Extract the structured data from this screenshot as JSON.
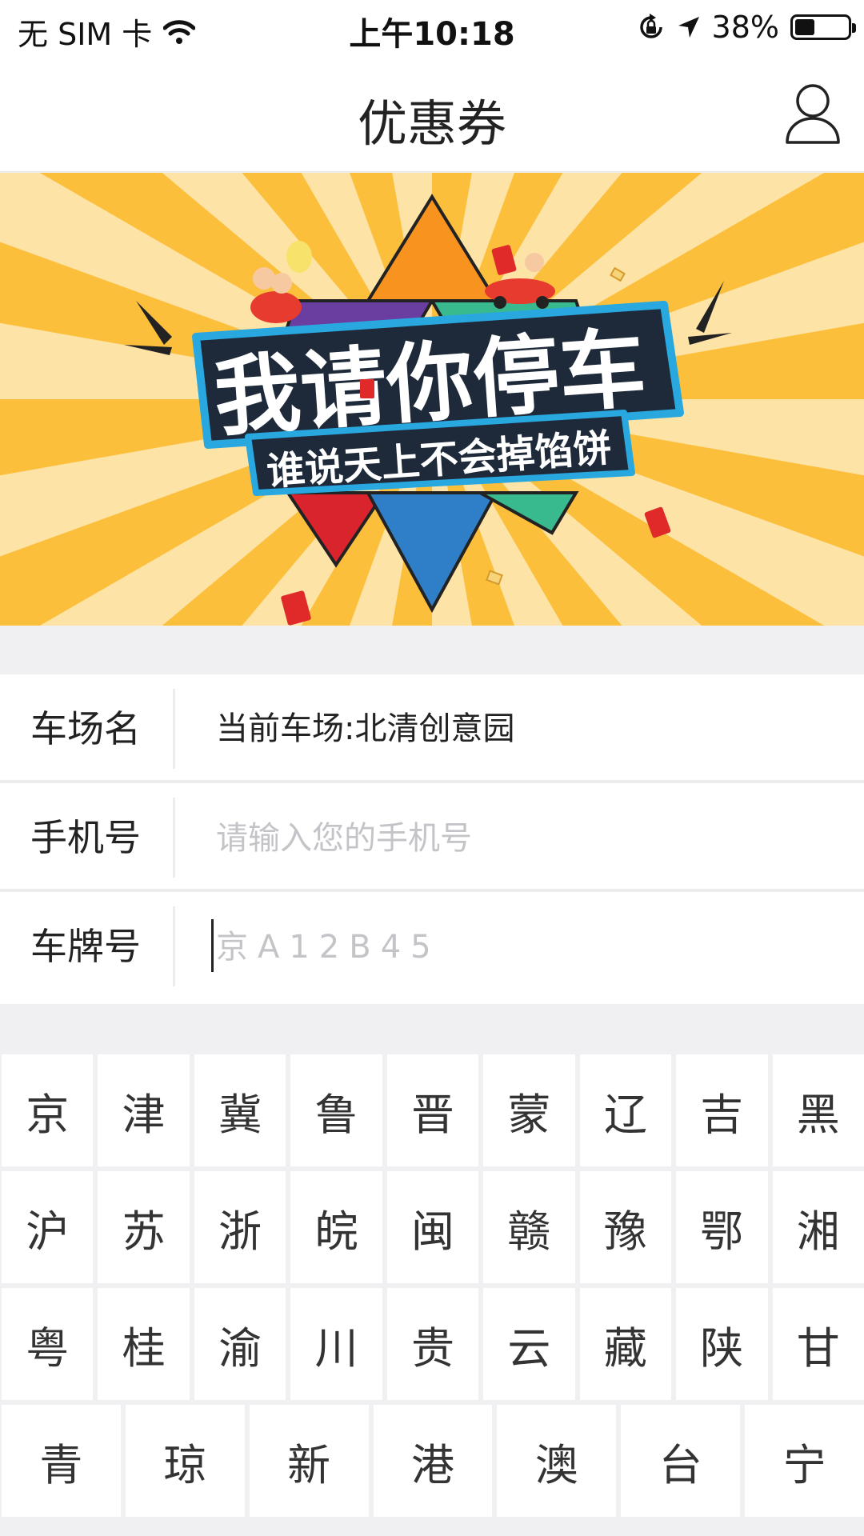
{
  "status_bar": {
    "carrier": "无 SIM 卡",
    "time": "上午10:18",
    "battery_percent": "38%",
    "battery_level": 0.38
  },
  "nav": {
    "title": "优惠券"
  },
  "banner": {
    "headline": "我请你停车",
    "subline": "谁说天上不会掉馅饼",
    "colors": {
      "background": "#fbbf3c",
      "rays": "#fde3a6",
      "orange": "#f7931e",
      "blue": "#2f7fc8",
      "green": "#38b98e",
      "purple": "#6a3ea1",
      "red": "#d9232d"
    }
  },
  "form": {
    "lot_label": "车场名",
    "lot_value": "当前车场:北清创意园",
    "phone_label": "手机号",
    "phone_placeholder": "请输入您的手机号",
    "plate_label": "车牌号",
    "plate_placeholder": "京A12B45"
  },
  "keyboard": {
    "rows": [
      [
        "京",
        "津",
        "冀",
        "鲁",
        "晋",
        "蒙",
        "辽",
        "吉",
        "黑"
      ],
      [
        "沪",
        "苏",
        "浙",
        "皖",
        "闽",
        "赣",
        "豫",
        "鄂",
        "湘"
      ],
      [
        "粤",
        "桂",
        "渝",
        "川",
        "贵",
        "云",
        "藏",
        "陕",
        "甘"
      ],
      [
        "青",
        "琼",
        "新",
        "港",
        "澳",
        "台",
        "宁"
      ]
    ]
  }
}
